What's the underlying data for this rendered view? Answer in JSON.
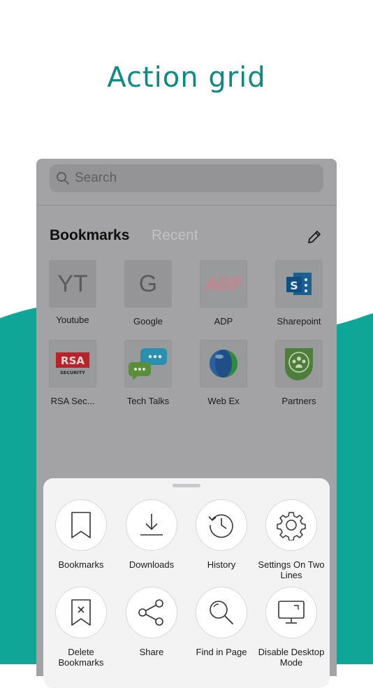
{
  "headline": "Action grid",
  "colors": {
    "teal": "#10a697",
    "headline": "#0f8a82"
  },
  "search": {
    "placeholder": "Search",
    "icon": "search-icon"
  },
  "tabs": {
    "active": "Bookmarks",
    "inactive": "Recent",
    "edit_icon": "pencil-icon"
  },
  "bookmarks": [
    {
      "label": "Youtube",
      "tile": "YT"
    },
    {
      "label": "Google",
      "tile": "G"
    },
    {
      "label": "ADP",
      "icon": "adp-logo"
    },
    {
      "label": "Sharepoint",
      "icon": "sharepoint-logo"
    },
    {
      "label": "RSA Sec...",
      "icon": "rsa-security-logo"
    },
    {
      "label": "Tech Talks",
      "icon": "chat-bubbles-logo"
    },
    {
      "label": "Web Ex",
      "icon": "webex-globe-logo"
    },
    {
      "label": "Partners",
      "icon": "partners-logo"
    }
  ],
  "actions": [
    {
      "label": "Bookmarks",
      "icon": "bookmark-icon"
    },
    {
      "label": "Downloads",
      "icon": "download-icon"
    },
    {
      "label": "History",
      "icon": "history-icon"
    },
    {
      "label": "Settings On Two Lines",
      "icon": "gear-icon"
    },
    {
      "label": "Delete Bookmarks",
      "icon": "delete-bookmark-icon"
    },
    {
      "label": "Share",
      "icon": "share-icon"
    },
    {
      "label": "Find in Page",
      "icon": "find-in-page-icon"
    },
    {
      "label": "Disable Desktop Mode",
      "icon": "desktop-icon"
    }
  ]
}
